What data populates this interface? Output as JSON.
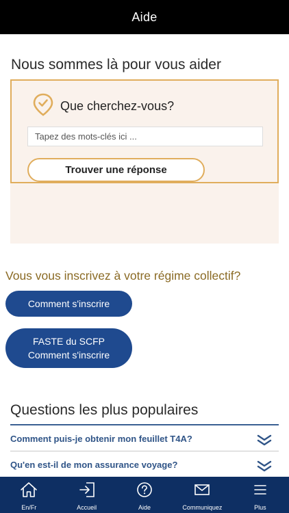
{
  "header": {
    "title": "Aide"
  },
  "hero": {
    "title": "Nous sommes là pour vous aider"
  },
  "search": {
    "prompt": "Que cherchez-vous?",
    "placeholder": "Tapez des mots-clés ici ...",
    "value": "",
    "button_label": "Trouver une réponse",
    "icon": "map-pin-check-icon"
  },
  "enroll": {
    "title": "Vous vous inscrivez à votre régime collectif?",
    "buttons": [
      {
        "line1": "Comment s'inscrire",
        "line2": ""
      },
      {
        "line1": "FASTE du SCFP",
        "line2": "Comment s'inscrire"
      }
    ]
  },
  "popular": {
    "title": "Questions les plus populaires",
    "items": [
      {
        "question": "Comment puis-je obtenir mon feuillet T4A?"
      },
      {
        "question": "Qu'en est-il de mon assurance voyage?"
      }
    ]
  },
  "tabbar": {
    "items": [
      {
        "label": "En/Fr",
        "icon": "home-icon"
      },
      {
        "label": "Accueil",
        "icon": "sign-in-icon"
      },
      {
        "label": "Aide",
        "icon": "help-icon"
      },
      {
        "label": "Communiquez",
        "icon": "envelope-icon"
      },
      {
        "label": "Plus",
        "icon": "menu-icon"
      }
    ]
  },
  "colors": {
    "header": "#000000",
    "accent": "#e0ad5c",
    "panel": "#faf2ec",
    "button": "#1f4a8f",
    "enroll_title": "#8a6a24",
    "faq_text": "#2f5487",
    "tabbar": "#0e2f63"
  }
}
